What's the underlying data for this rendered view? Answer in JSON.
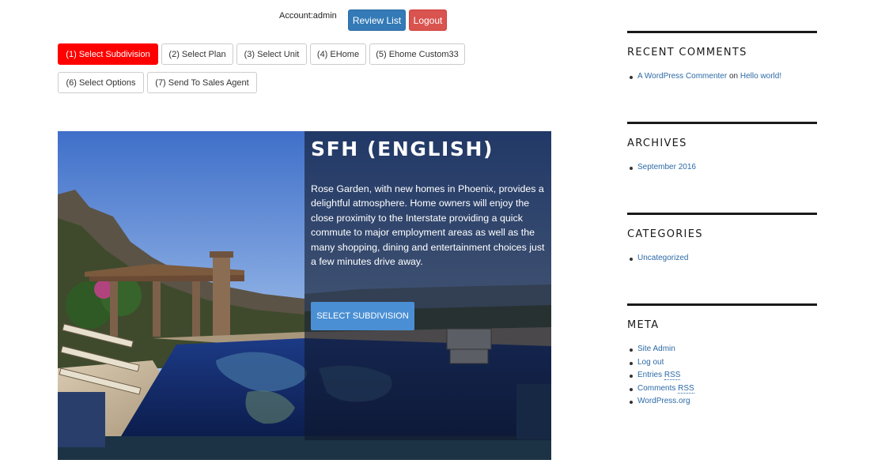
{
  "header": {
    "account_label": "Account:admin",
    "review_list": "Review List",
    "logout": "Logout"
  },
  "steps": [
    {
      "label": "(1) Select Subdivision",
      "active": true
    },
    {
      "label": "(2) Select Plan",
      "active": false
    },
    {
      "label": "(3) Select Unit",
      "active": false
    },
    {
      "label": "(4) EHome",
      "active": false
    },
    {
      "label": "(5) Ehome Custom33",
      "active": false
    },
    {
      "label": "(6) Select Options",
      "active": false
    },
    {
      "label": "(7) Send To Sales Agent",
      "active": false
    }
  ],
  "hero": {
    "title": "SFH (ENGLISH)",
    "description": "Rose Garden, with new homes in Phoenix, provides a delightful atmosphere. Home owners will enjoy the close proximity to the Interstate providing a quick commute to major employment areas as well as the many shopping, dining and entertainment choices just a few minutes drive away.",
    "button": "SELECT SUBDIVISION"
  },
  "sidebar": {
    "recent_comments": {
      "title": "RECENT COMMENTS",
      "author": "A WordPress Commenter",
      "connector": "on",
      "post": "Hello world!"
    },
    "archives": {
      "title": "ARCHIVES",
      "items": [
        "September 2016"
      ]
    },
    "categories": {
      "title": "CATEGORIES",
      "items": [
        "Uncategorized"
      ]
    },
    "meta": {
      "title": "META",
      "site_admin": "Site Admin",
      "log_out": "Log out",
      "entries": "Entries",
      "comments": "Comments",
      "rss": "RSS",
      "wordpress_org": "WordPress.org"
    }
  },
  "colors": {
    "active_step": "#ff0000",
    "primary": "#337ab7",
    "danger": "#d9534f",
    "hero_button": "#4a8fd4",
    "link": "#2c6aa6"
  }
}
